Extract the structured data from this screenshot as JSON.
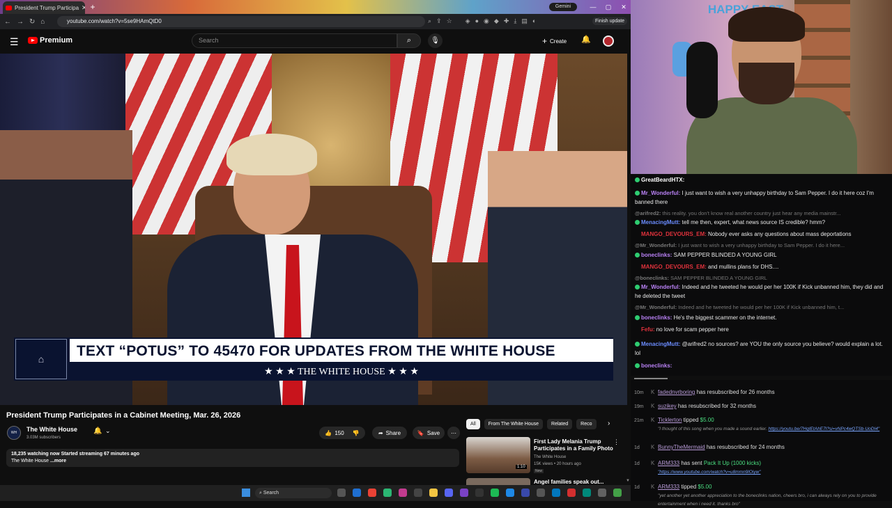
{
  "browser": {
    "tab_title": "President Trump Participa",
    "gemini_label": "Gemini",
    "url": "youtube.com/watch?v=5se9HAmQtD0",
    "finish_update": "Finish update"
  },
  "youtube": {
    "brand": "Premium",
    "search_placeholder": "Search",
    "create_label": "Create"
  },
  "video": {
    "banner_text": "TEXT “POTUS” TO 45470 FOR UPDATES FROM THE WHITE HOUSE",
    "banner_sub": "★ ★ ★  THE WHITE HOUSE  ★ ★ ★",
    "title": "President Trump Participates in a Cabinet Meeting, Mar. 26, 2026",
    "channel_name": "The White House",
    "subscribers": "3.03M subscribers",
    "likes": "150",
    "share_label": "Share",
    "save_label": "Save",
    "desc_line1": "18,235 watching now  Started streaming 67 minutes ago",
    "desc_line2": "The White House",
    "desc_more": "...more"
  },
  "recs": {
    "chips": [
      "All",
      "From The White House",
      "Related",
      "Reco"
    ],
    "item1": {
      "title": "First Lady Melania Trump Participates in a Family Photo",
      "channel": "The White House",
      "meta": "15K views • 20 hours ago",
      "badge": "New",
      "duration": "1:10"
    },
    "item2_title": "Angel families speak out..."
  },
  "taskbar": {
    "search_label": "Search"
  },
  "stream": {
    "sign": "HAPPY EAST"
  },
  "chat": [
    {
      "user": "GreatBeardHTX:",
      "text": "",
      "color": "#ffffff",
      "dim": false
    },
    {
      "user": "Mr_Wonderful:",
      "text": "I just want to wish a very unhappy birthday to Sam Pepper. I do it here coz I'm banned there",
      "color": "#b981f5",
      "dim": false
    },
    {
      "user": "@arifred2:",
      "text": "this reality. you don't know real another country just hear any media mainstr...",
      "color": "#777",
      "dim": true
    },
    {
      "user": "MenacingMutt:",
      "text": "tell me then, expert, what news source IS credible? hmm?",
      "color": "#6b8cff",
      "dim": false
    },
    {
      "user": "MANGO_DEVOURS_EM:",
      "text": "Nobody ever asks any questions about mass deportations",
      "color": "#e0323c",
      "dim": false
    },
    {
      "user": "@Mr_Wonderful:",
      "text": "I just want to wish a very unhappy birthday to Sam Pepper. I do it here...",
      "color": "#777",
      "dim": true
    },
    {
      "user": "boneclinks:",
      "text": "SAM PEPPER BLINDED A YOUNG GIRL",
      "color": "#b981f5",
      "dim": false
    },
    {
      "user": "MANGO_DEVOURS_EM:",
      "text": "and mullins plans for DHS....",
      "color": "#e0323c",
      "dim": false
    },
    {
      "user": "@boneclinks:",
      "text": "SAM PEPPER BLINDED A YOUNG GIRL",
      "color": "#777",
      "dim": true
    },
    {
      "user": "Mr_Wonderful:",
      "text": "Indeed and he tweeted he would per her 100K if Kick unbanned him, they did and he deleted the tweet",
      "color": "#b981f5",
      "dim": false
    },
    {
      "user": "@Mr_Wonderful:",
      "text": "Indeed and he tweeted he would per her 100K if Kick unbanned him, t...",
      "color": "#777",
      "dim": true
    },
    {
      "user": "boneclinks:",
      "text": "He's the biggest scammer on the internet.",
      "color": "#b981f5",
      "dim": false
    },
    {
      "user": "Fefu:",
      "text": "no love for scam pepper here",
      "color": "#e0323c",
      "dim": false
    },
    {
      "user": "MenacingMutt:",
      "text": "@arifred2 no sources? are YOU the only source you believe? would explain a lot. lol",
      "color": "#6b8cff",
      "dim": false
    },
    {
      "user": "boneclinks:",
      "text": "",
      "color": "#b981f5",
      "dim": false
    }
  ],
  "events": [
    {
      "time": "10m",
      "name": "fadednvrboring",
      "text": "has resubscribed for 26 months"
    },
    {
      "time": "19m",
      "name": "suzikey",
      "text": "has resubscribed for 32 months"
    },
    {
      "time": "21m",
      "name": "Ticklerton",
      "text": "tipped",
      "amount": "$5.00",
      "quote": "\"I thought of this song when you made a sound earlier.",
      "link": "https://youtu.be/7HqIEtAhE7I?si=vNPc4wQTSb-UoDI4\""
    },
    {
      "time": "1d",
      "name": "BunnyTheMermaid",
      "text": "has resubscribed for 24 months"
    },
    {
      "time": "1d",
      "name": "ARM333",
      "text": "has sent",
      "amount": "Pack It Up (1000 kicks)",
      "link": "\"https://www.youtube.com/watch?v=u8mmn9lOiyw\""
    },
    {
      "time": "1d",
      "name": "ARM333",
      "text": "tipped",
      "amount": "$5.00",
      "quote": "\"yet another yet another appreciation to the boneclinks nation, cheers bro, i can always rely on you to provide entertainment when i need it. thanks bro\""
    }
  ]
}
